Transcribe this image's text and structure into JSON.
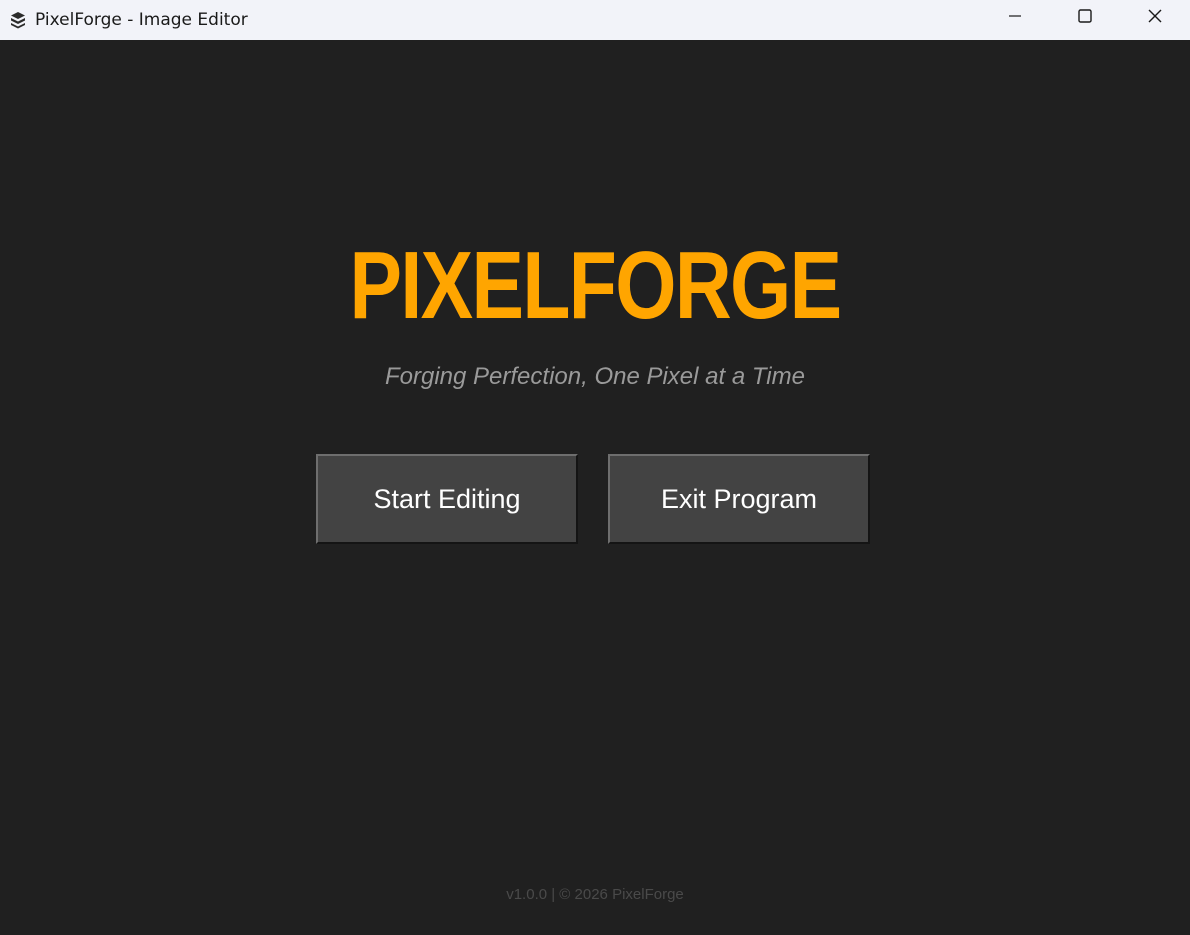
{
  "window": {
    "title": "PixelForge - Image Editor",
    "icon": "app-logo-icon"
  },
  "controls": {
    "minimize_icon": "minimize-icon",
    "maximize_icon": "maximize-icon",
    "close_icon": "close-icon"
  },
  "splash": {
    "logo": "PIXELFORGE",
    "tagline": "Forging Perfection, One Pixel at a Time",
    "start_label": "Start Editing",
    "exit_label": "Exit Program",
    "footer": "v1.0.0 | © 2026 PixelForge"
  },
  "colors": {
    "background": "#202020",
    "accent": "#ffa500",
    "button_bg": "#434343",
    "tagline": "#9a9a9a",
    "footer": "#4a4a4a"
  }
}
